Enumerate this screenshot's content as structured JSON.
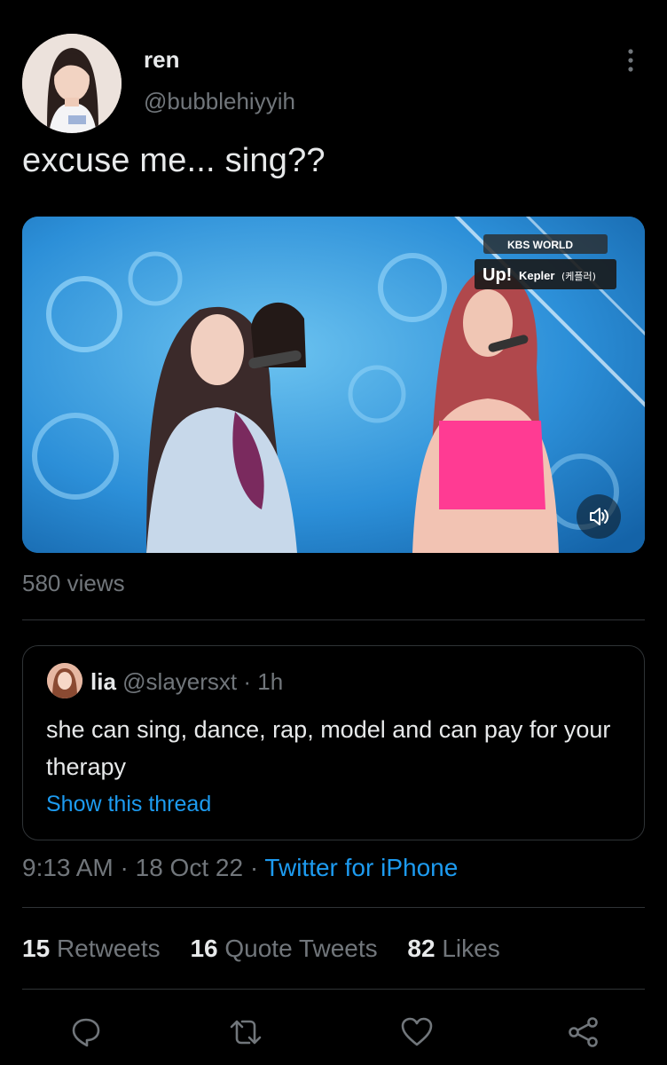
{
  "tweet": {
    "display_name": "ren",
    "handle": "@bubblehiyyih",
    "text": "excuse me... sing??",
    "more_icon": "more-vertical-icon",
    "media": {
      "channel_logo": "KBS WORLD",
      "caption_prefix": "Up!",
      "caption_artist": "Kepler",
      "caption_korean": "(케플러)",
      "volume_icon": "speaker-icon"
    },
    "views": "580 views"
  },
  "quoted_tweet": {
    "name": "lia",
    "handle": "@slayersxt",
    "time": "· 1h",
    "text": "she can sing, dance, rap, model and can pay for your therapy",
    "link": "Show this thread"
  },
  "meta": {
    "time": "9:13 AM",
    "date": "18 Oct 22",
    "separator": "·",
    "source": "Twitter for iPhone"
  },
  "stats": {
    "retweets_count": "15",
    "retweets_label": "Retweets",
    "quotes_count": "16",
    "quotes_label": "Quote Tweets",
    "likes_count": "82",
    "likes_label": "Likes"
  },
  "actions": [
    "reply-icon",
    "retweet-icon",
    "like-icon",
    "share-icon"
  ],
  "colors": {
    "background": "#000000",
    "text": "#e7e9ea",
    "secondary": "#71767b",
    "accent": "#1d9bf0",
    "border": "#2f3336"
  }
}
